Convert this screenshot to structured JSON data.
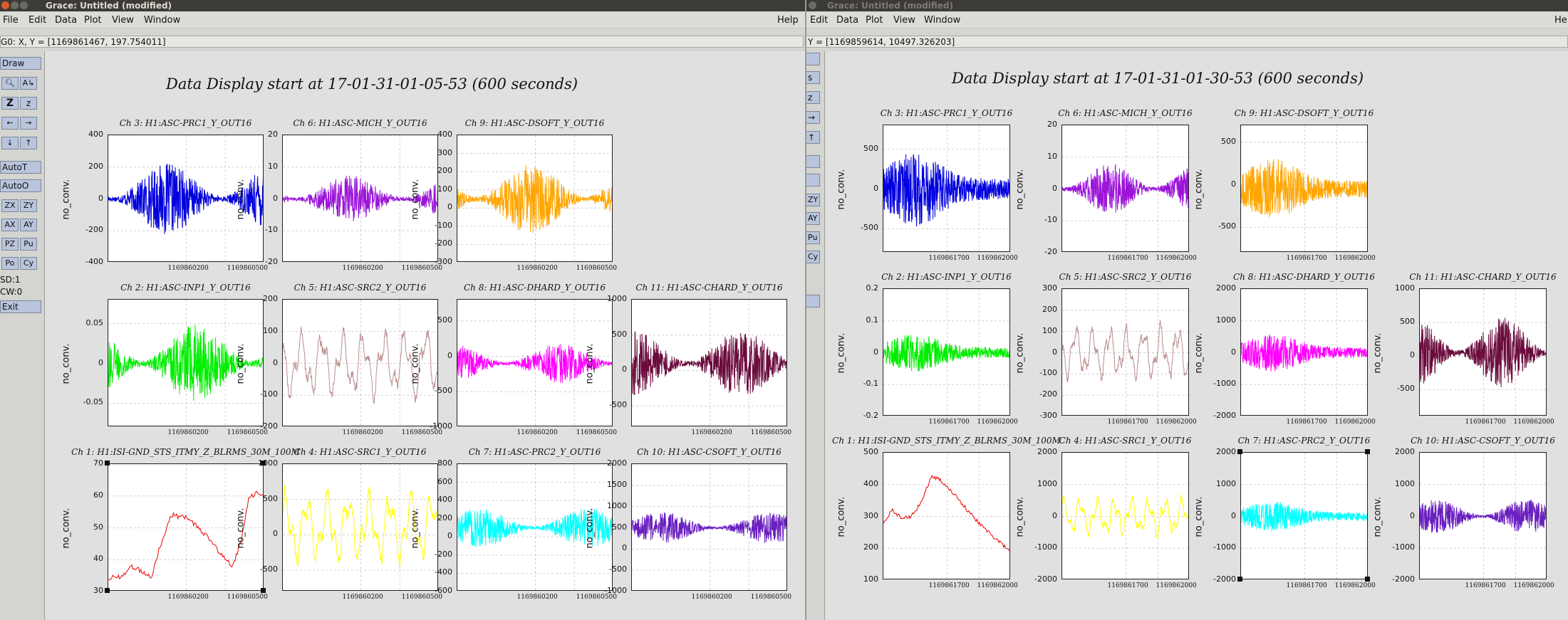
{
  "windows": [
    {
      "title": "Grace: Untitled (modified)",
      "menus": [
        "File",
        "Edit",
        "Data",
        "Plot",
        "View",
        "Window"
      ],
      "help": "Help",
      "locator": "G0: X, Y = [1169861467, 197.754011]",
      "tools": [
        "Draw",
        "AutoT",
        "AutoO",
        "Exit"
      ],
      "small_tools": [
        "ZX",
        "ZY",
        "AX",
        "AY",
        "PZ",
        "Pu",
        "Po",
        "Cy"
      ],
      "status": [
        "SD:1",
        "CW:0"
      ],
      "suptitle": "Data Display start at 17-01-31-01-05-53 (600 seconds)",
      "graphs": [
        {
          "title": "Ch 3: H1:ASC-PRC1_Y_OUT16",
          "ylabel": "no_conv.",
          "yticks": [
            "400",
            "200",
            "0",
            "-200",
            "-400"
          ],
          "ylim": [
            -400,
            400
          ],
          "xticks": [
            "1169860200",
            "1169860500"
          ],
          "color": "#0000dd",
          "kind": "noise",
          "amp": 0.45
        },
        {
          "title": "Ch 6: H1:ASC-MICH_Y_OUT16",
          "ylabel": "no_conv.",
          "yticks": [
            "20",
            "10",
            "0",
            "-10",
            "-20"
          ],
          "ylim": [
            -20,
            20
          ],
          "xticks": [
            "1169860200",
            "1169860500"
          ],
          "color": "#9b14d8",
          "kind": "noise",
          "amp": 0.3
        },
        {
          "title": "Ch 9: H1:ASC-DSOFT_Y_OUT16",
          "ylabel": "no_conv.",
          "yticks": [
            "400",
            "300",
            "200",
            "100",
            "0",
            "-100",
            "-200",
            "-300"
          ],
          "ylim": [
            -300,
            400
          ],
          "xticks": [
            "1169860200",
            "1169860500"
          ],
          "color": "#ffa500",
          "kind": "noise",
          "amp": 0.45
        },
        null,
        {
          "title": "Ch 2: H1:ASC-INP1_Y_OUT16",
          "ylabel": "no_conv.",
          "yticks": [
            "0.05",
            "0",
            "-0.05"
          ],
          "ylim": [
            -0.08,
            0.08
          ],
          "xticks": [
            "1169860200",
            "1169860500"
          ],
          "color": "#00ee00",
          "kind": "noise",
          "amp": 0.5
        },
        {
          "title": "Ch 5: H1:ASC-SRC2_Y_OUT16",
          "ylabel": "no_conv.",
          "yticks": [
            "200",
            "100",
            "0",
            "-100",
            "-200"
          ],
          "ylim": [
            -200,
            200
          ],
          "xticks": [
            "1169860200",
            "1169860500"
          ],
          "color": "#bc8f8f",
          "kind": "wave",
          "amp": 0.38
        },
        {
          "title": "Ch 8: H1:ASC-DHARD_Y_OUT16",
          "ylabel": "no_conv.",
          "yticks": [
            "500",
            "0",
            "-500",
            "-1000"
          ],
          "ylim": [
            -1000,
            800
          ],
          "xticks": [
            "1169860200",
            "1169860500"
          ],
          "color": "#ff00ff",
          "kind": "noise",
          "amp": 0.25
        },
        {
          "title": "Ch 11: H1:ASC-CHARD_Y_OUT16",
          "ylabel": "no_conv.",
          "yticks": [
            "1000",
            "500",
            "0",
            "-500"
          ],
          "ylim": [
            -800,
            1000
          ],
          "xticks": [
            "1169860200",
            "1169860500"
          ],
          "color": "#6a0b3c",
          "kind": "noise",
          "amp": 0.42
        },
        {
          "title": "Ch 1: H1:ISI-GND_STS_ITMY_Z_BLRMS_30M_100M",
          "ylabel": "no_conv.",
          "yticks": [
            "70",
            "60",
            "50",
            "40",
            "30"
          ],
          "ylim": [
            30,
            70
          ],
          "xticks": [
            "1169860200",
            "1169860500"
          ],
          "color": "#ee0000",
          "kind": "trendA",
          "amp": 1,
          "selected": true
        },
        {
          "title": "Ch 4: H1:ASC-SRC1_Y_OUT16",
          "ylabel": "no_conv.",
          "yticks": [
            "1000",
            "500",
            "0",
            "-500"
          ],
          "ylim": [
            -800,
            1000
          ],
          "xticks": [
            "1169860200",
            "1169860500"
          ],
          "color": "#ffff00",
          "kind": "wave",
          "amp": 0.4
        },
        {
          "title": "Ch 7: H1:ASC-PRC2_Y_OUT16",
          "ylabel": "no_conv.",
          "yticks": [
            "800",
            "600",
            "400",
            "200",
            "0",
            "-200",
            "-400",
            "-600"
          ],
          "ylim": [
            -600,
            800
          ],
          "xticks": [
            "1169860200",
            "1169860500"
          ],
          "color": "#00ffff",
          "kind": "noise",
          "amp": 0.25
        },
        {
          "title": "Ch 10: H1:ASC-CSOFT_Y_OUT16",
          "ylabel": "no_conv.",
          "yticks": [
            "2000",
            "1500",
            "1000",
            "500",
            "0",
            "-500",
            "-1000"
          ],
          "ylim": [
            -1000,
            2000
          ],
          "xticks": [
            "1169860200",
            "1169860500"
          ],
          "color": "#6a1fc0",
          "kind": "noise",
          "amp": 0.2
        }
      ]
    },
    {
      "title": "Grace: Untitled (modified)",
      "menus": [
        "Edit",
        "Data",
        "Plot",
        "View",
        "Window"
      ],
      "help": "He",
      "locator": "Y = [1169859614, 10497.326203]",
      "suptitle": "Data Display start at 17-01-31-01-30-53 (600 seconds)",
      "graphs": [
        {
          "title": "Ch 3: H1:ASC-PRC1_Y_OUT16",
          "ylabel": "no_conv.",
          "yticks": [
            "500",
            "0",
            "-500"
          ],
          "ylim": [
            -800,
            800
          ],
          "xticks": [
            "1169861700",
            "1169862000"
          ],
          "color": "#0000dd",
          "kind": "burst",
          "amp": 0.5
        },
        {
          "title": "Ch 6: H1:ASC-MICH_Y_OUT16",
          "ylabel": "no_conv.",
          "yticks": [
            "20",
            "10",
            "0",
            "-10",
            "-20"
          ],
          "ylim": [
            -20,
            20
          ],
          "xticks": [
            "1169861700",
            "1169862000"
          ],
          "color": "#9b14d8",
          "kind": "noise",
          "amp": 0.32
        },
        {
          "title": "Ch 9: H1:ASC-DSOFT_Y_OUT16",
          "ylabel": "no_conv.",
          "yticks": [
            "500",
            "0",
            "-500"
          ],
          "ylim": [
            -800,
            700
          ],
          "xticks": [
            "1169861700",
            "1169862000"
          ],
          "color": "#ffa500",
          "kind": "burst",
          "amp": 0.4
        },
        null,
        {
          "title": "Ch 2: H1:ASC-INP1_Y_OUT16",
          "ylabel": "no_conv.",
          "yticks": [
            "0.2",
            "0.1",
            "0",
            "-0.1",
            "-0.2"
          ],
          "ylim": [
            -0.2,
            0.2
          ],
          "xticks": [
            "1169861700",
            "1169862000"
          ],
          "color": "#00ee00",
          "kind": "burst",
          "amp": 0.25
        },
        {
          "title": "Ch 5: H1:ASC-SRC2_Y_OUT16",
          "ylabel": "no_conv.",
          "yticks": [
            "300",
            "200",
            "100",
            "0",
            "-100",
            "-200",
            "-300"
          ],
          "ylim": [
            -300,
            300
          ],
          "xticks": [
            "1169861700",
            "1169862000"
          ],
          "color": "#bc8f8f",
          "kind": "wave",
          "amp": 0.3
        },
        {
          "title": "Ch 8: H1:ASC-DHARD_Y_OUT16",
          "ylabel": "no_conv.",
          "yticks": [
            "2000",
            "1000",
            "0",
            "-1000",
            "-2000"
          ],
          "ylim": [
            -2000,
            2000
          ],
          "xticks": [
            "1169861700",
            "1169862000"
          ],
          "color": "#ff00ff",
          "kind": "burst",
          "amp": 0.25
        },
        {
          "title": "Ch 11: H1:ASC-CHARD_Y_OUT16",
          "ylabel": "no_conv.",
          "yticks": [
            "1000",
            "500",
            "0",
            "-500"
          ],
          "ylim": [
            -900,
            1000
          ],
          "xticks": [
            "1169861700",
            "1169862000"
          ],
          "color": "#6a0b3c",
          "kind": "noise",
          "amp": 0.45
        },
        {
          "title": "Ch 1: H1:ISI-GND_STS_ITMY_Z_BLRMS_30M_100M",
          "ylabel": "no_conv.",
          "yticks": [
            "500",
            "400",
            "300",
            "200",
            "100"
          ],
          "ylim": [
            100,
            500
          ],
          "xticks": [
            "1169861700",
            "1169862000"
          ],
          "color": "#ee0000",
          "kind": "trendB",
          "amp": 1
        },
        {
          "title": "Ch 4: H1:ASC-SRC1_Y_OUT16",
          "ylabel": "no_conv.",
          "yticks": [
            "2000",
            "1000",
            "0",
            "-1000",
            "-2000"
          ],
          "ylim": [
            -2000,
            2000
          ],
          "xticks": [
            "1169861700",
            "1169862000"
          ],
          "color": "#ffff00",
          "kind": "wave",
          "amp": 0.22
        },
        {
          "title": "Ch 7: H1:ASC-PRC2_Y_OUT16",
          "ylabel": "no_conv.",
          "yticks": [
            "2000",
            "1000",
            "0",
            "-1000",
            "-2000"
          ],
          "ylim": [
            -2000,
            2000
          ],
          "xticks": [
            "1169861700",
            "1169862000"
          ],
          "color": "#00ffff",
          "kind": "burst",
          "amp": 0.2,
          "selected": true
        },
        {
          "title": "Ch 10: H1:ASC-CSOFT_Y_OUT16",
          "ylabel": "no_conv.",
          "yticks": [
            "2000",
            "1000",
            "0",
            "-1000",
            "-2000"
          ],
          "ylim": [
            -2000,
            2000
          ],
          "xticks": [
            "1169861700",
            "1169862000"
          ],
          "color": "#6a1fc0",
          "kind": "noise",
          "amp": 0.22
        }
      ]
    }
  ]
}
